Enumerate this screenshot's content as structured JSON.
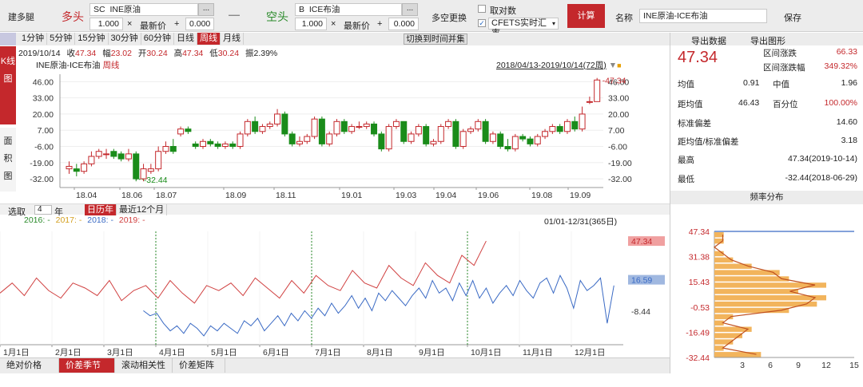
{
  "toolbar": {
    "build_leg": "建多腿",
    "long_label": "多头",
    "short_label": "空头",
    "leg1_prefix": "SC",
    "leg1_value": "INE原油",
    "leg2_prefix": "B",
    "leg2_value": "ICE布油",
    "qty1": "1.000",
    "qty2": "1.000",
    "price_label": "最新价",
    "offset1": "0.000",
    "offset2": "0.000",
    "times": "×",
    "plus": "+",
    "minus_sign": "—",
    "more_btn": "...",
    "swap_label": "多空更换",
    "log_label": "取对数",
    "fx_label": "CFETS实时汇率",
    "calc_btn": "计算",
    "name_label": "名称",
    "name_value": "INE原油-ICE布油",
    "save_btn": "保存",
    "red": "#c4282c"
  },
  "period_tabs": [
    "1分钟",
    "5分钟",
    "15分钟",
    "30分钟",
    "60分钟",
    "日线",
    "周线",
    "月线"
  ],
  "active_period": "周线",
  "switch_btn": "切换到时间并集",
  "side_tabs": {
    "kline": "K线图",
    "area": "面积图"
  },
  "kline": {
    "date": "2019/10/14",
    "close_label": "收",
    "close": "47.34",
    "range_label": "幅",
    "range": "23.02",
    "open_label": "开",
    "open": "30.24",
    "high_label": "高",
    "high": "47.34",
    "low_label": "低",
    "low": "30.24",
    "amp_label": "振",
    "amp": "2.39%",
    "series_name": "INE原油-ICE布油",
    "freq": "周线",
    "date_range": "2018/04/13-2019/10/14(72周)",
    "y_ticks": [
      "46.00",
      "33.00",
      "20.00",
      "7.00",
      "-6.00",
      "-19.00",
      "-32.00"
    ],
    "x_ticks": [
      "18.04",
      "18.06",
      "18.07",
      "18.09",
      "18.11",
      "19.01",
      "19.03",
      "19.04",
      "19.06",
      "19.08",
      "19.09"
    ],
    "max_label": "47.34",
    "min_label": "-32.44"
  },
  "chart_data": [
    {
      "type": "candlestick",
      "title": "INE原油-ICE布油 周线",
      "ylim": [
        -39,
        52
      ],
      "opens": [
        -24,
        -24,
        -26,
        -20,
        -14,
        -12,
        -10,
        -12,
        -16,
        -12,
        -32,
        -26,
        -24,
        -10,
        -6,
        4,
        8,
        -4,
        -6,
        -2,
        -4,
        -6,
        -4,
        -6,
        4,
        14,
        6,
        10,
        12,
        20,
        4,
        -4,
        -2,
        2,
        16,
        -4,
        4,
        14,
        6,
        10,
        10,
        12,
        4,
        -8,
        10,
        14,
        -2,
        4,
        10,
        -4,
        -2,
        10,
        14,
        -6,
        6,
        8,
        14,
        -2,
        4,
        -6,
        -8,
        2,
        0,
        -4,
        2,
        6,
        10,
        6,
        14,
        8,
        30,
        30
      ],
      "closes": [
        -22,
        -26,
        -20,
        -14,
        -10,
        -12,
        -14,
        -16,
        -12,
        -32,
        -24,
        -24,
        -10,
        -6,
        -10,
        8,
        6,
        -6,
        -2,
        -4,
        -6,
        -4,
        -6,
        4,
        14,
        6,
        10,
        12,
        20,
        4,
        -4,
        -2,
        2,
        16,
        -4,
        4,
        14,
        6,
        10,
        10,
        12,
        4,
        -8,
        10,
        14,
        -2,
        4,
        10,
        -4,
        -2,
        10,
        14,
        -6,
        6,
        8,
        14,
        -2,
        4,
        -6,
        -8,
        2,
        0,
        -4,
        2,
        6,
        10,
        6,
        14,
        8,
        20,
        30,
        47.34
      ],
      "highs": [
        -18,
        -20,
        -18,
        -10,
        -8,
        -8,
        -8,
        -10,
        -8,
        -10,
        -20,
        -20,
        -6,
        -2,
        0,
        10,
        10,
        -2,
        0,
        0,
        -2,
        -2,
        -2,
        6,
        16,
        18,
        12,
        14,
        24,
        22,
        6,
        2,
        4,
        18,
        18,
        6,
        16,
        16,
        12,
        14,
        14,
        14,
        6,
        12,
        16,
        14,
        6,
        12,
        12,
        0,
        12,
        16,
        16,
        8,
        10,
        16,
        16,
        6,
        6,
        0,
        4,
        4,
        2,
        4,
        8,
        12,
        12,
        16,
        18,
        26,
        34,
        49
      ],
      "lows": [
        -28,
        -30,
        -28,
        -22,
        -16,
        -16,
        -16,
        -18,
        -18,
        -34,
        -34,
        -28,
        -26,
        -12,
        -12,
        2,
        4,
        -8,
        -8,
        -6,
        -8,
        -8,
        -8,
        -8,
        2,
        4,
        4,
        8,
        10,
        2,
        -6,
        -6,
        -4,
        0,
        -6,
        -6,
        2,
        4,
        4,
        8,
        8,
        2,
        -10,
        -10,
        8,
        -4,
        -4,
        2,
        -6,
        -6,
        -4,
        8,
        -8,
        -8,
        4,
        6,
        -4,
        -4,
        -8,
        -10,
        -10,
        -2,
        -6,
        -6,
        0,
        4,
        4,
        4,
        6,
        6,
        28,
        30
      ]
    },
    {
      "type": "line",
      "title": "价差季节图",
      "x_range": "01/01-12/31(365日)",
      "ylim": [
        -35,
        55
      ],
      "series": [
        {
          "name": "2016:",
          "values": []
        },
        {
          "name": "2017:",
          "values": []
        },
        {
          "name": "2018:",
          "values": [
            -8,
            -12,
            -10,
            -18,
            -24,
            -20,
            -26,
            -18,
            -22,
            -28,
            -20,
            -24,
            -18,
            -22,
            -26,
            -16,
            -20,
            -14,
            -24,
            -18,
            -12,
            -20,
            -10,
            -16,
            -8,
            -14,
            -6,
            -12,
            -2,
            -10,
            -4,
            4,
            -6,
            2,
            -8,
            6,
            0,
            8,
            2,
            -4,
            4,
            10,
            2,
            16,
            6,
            10,
            0,
            14,
            4,
            16,
            2,
            10,
            -2,
            6,
            12,
            4,
            16,
            8,
            2,
            14,
            18,
            6,
            20,
            10,
            -6,
            16,
            8,
            12,
            18,
            -18,
            12
          ]
        },
        {
          "name": "2019:",
          "values": [
            6,
            14,
            4,
            18,
            8,
            2,
            14,
            10,
            4,
            16,
            0,
            8,
            12,
            2,
            16,
            6,
            -2,
            12,
            8,
            14,
            4,
            18,
            10,
            2,
            16,
            6,
            20,
            12,
            8,
            24,
            14,
            10,
            28,
            18,
            12,
            30,
            20,
            14,
            36,
            28,
            47.34
          ]
        }
      ],
      "ticks": [
        "47.34",
        "16.59",
        "-8.44"
      ]
    },
    {
      "type": "bar",
      "title": "频率分布",
      "y_labels": [
        "47.34",
        "31.38",
        "15.43",
        "-0.53",
        "-16.49",
        "-32.44"
      ],
      "x_labels": [
        "3",
        "6",
        "9",
        "12",
        "15"
      ],
      "values": [
        1,
        1,
        0,
        1,
        2,
        4,
        7,
        8,
        12,
        9,
        12,
        11,
        8,
        2,
        1,
        4,
        3,
        2,
        1,
        5
      ]
    }
  ],
  "select_label": "选取",
  "select_value": "4",
  "year_label": "年",
  "calendar_tabs": [
    "日历年",
    "最近12个月"
  ],
  "legend": {
    "y2016": "2016: -",
    "y2017": "2017: -",
    "y2018": "2018: -",
    "y2019": "2019: -"
  },
  "season_x": [
    "1月1日",
    "2月1日",
    "3月1日",
    "4月1日",
    "5月1日",
    "6月1日",
    "7月1日",
    "8月1日",
    "9月1日",
    "10月1日",
    "11月1日",
    "12月1日"
  ],
  "bottom_tabs": [
    "绝对价格",
    "价差季节图",
    "滚动相关性",
    "价差矩阵"
  ],
  "stats": {
    "export_data": "导出数据",
    "export_chart": "导出图形",
    "price": "47.34",
    "range_chg_label": "区间涨跌",
    "range_chg": "66.33",
    "range_pct_label": "区间涨跌幅",
    "range_pct": "349.32%",
    "mean_label": "均值",
    "mean": "0.91",
    "median_label": "中值",
    "median": "1.96",
    "dist_label": "距均值",
    "dist": "46.43",
    "pctl_label": "百分位",
    "pctl": "100.00%",
    "std_label": "标准偏差",
    "std": "14.60",
    "ratio_label": "距均值/标准偏差",
    "ratio": "3.18",
    "max_label": "最高",
    "max": "47.34(2019-10-14)",
    "min_label": "最低",
    "min": "-32.44(2018-06-29)",
    "freq_title": "频率分布"
  }
}
